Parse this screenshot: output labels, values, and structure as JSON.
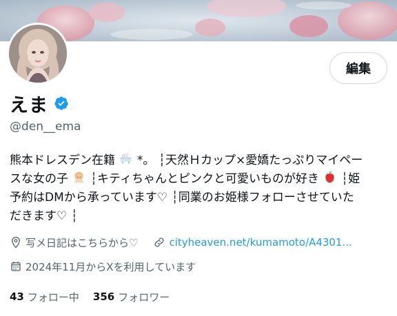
{
  "profile": {
    "edit_button_label": "編集",
    "display_name": "えま",
    "handle": "@den__ema",
    "bio_lines": [
      {
        "segments": [
          "熊本ドレスデン在籍",
          "*。 ┆天然Ｈカップ×愛嬌たっぷりマイペー"
        ]
      },
      {
        "segments": [
          "スな女の子",
          "┆キティちゃんとピンクと可愛いものが好き",
          "┆姫"
        ]
      },
      {
        "segments": [
          "予約はDMから承っています♡ ┆同業のお姫様フォローさせていた"
        ]
      },
      {
        "segments": [
          "だきます♡ ┆"
        ]
      }
    ],
    "location": "写メ日記はこちらから♡",
    "website": "cityheaven.net/kumamoto/A4301...",
    "joined": "2024年11月からXを利用しています",
    "following_count": "43",
    "following_label": "フォロー中",
    "followers_count": "356",
    "followers_label": "フォロワー"
  },
  "icons": {
    "verified": "verified-badge-icon",
    "bath": "bathtub-emoji",
    "girl": "person-emoji",
    "apple": "red-apple-emoji",
    "location": "location-pin-icon",
    "link": "link-icon",
    "calendar": "calendar-icon"
  },
  "colors": {
    "accent": "#1d9bf0",
    "text_primary": "#0f1419",
    "text_secondary": "#536471",
    "border": "#cfd9de"
  }
}
